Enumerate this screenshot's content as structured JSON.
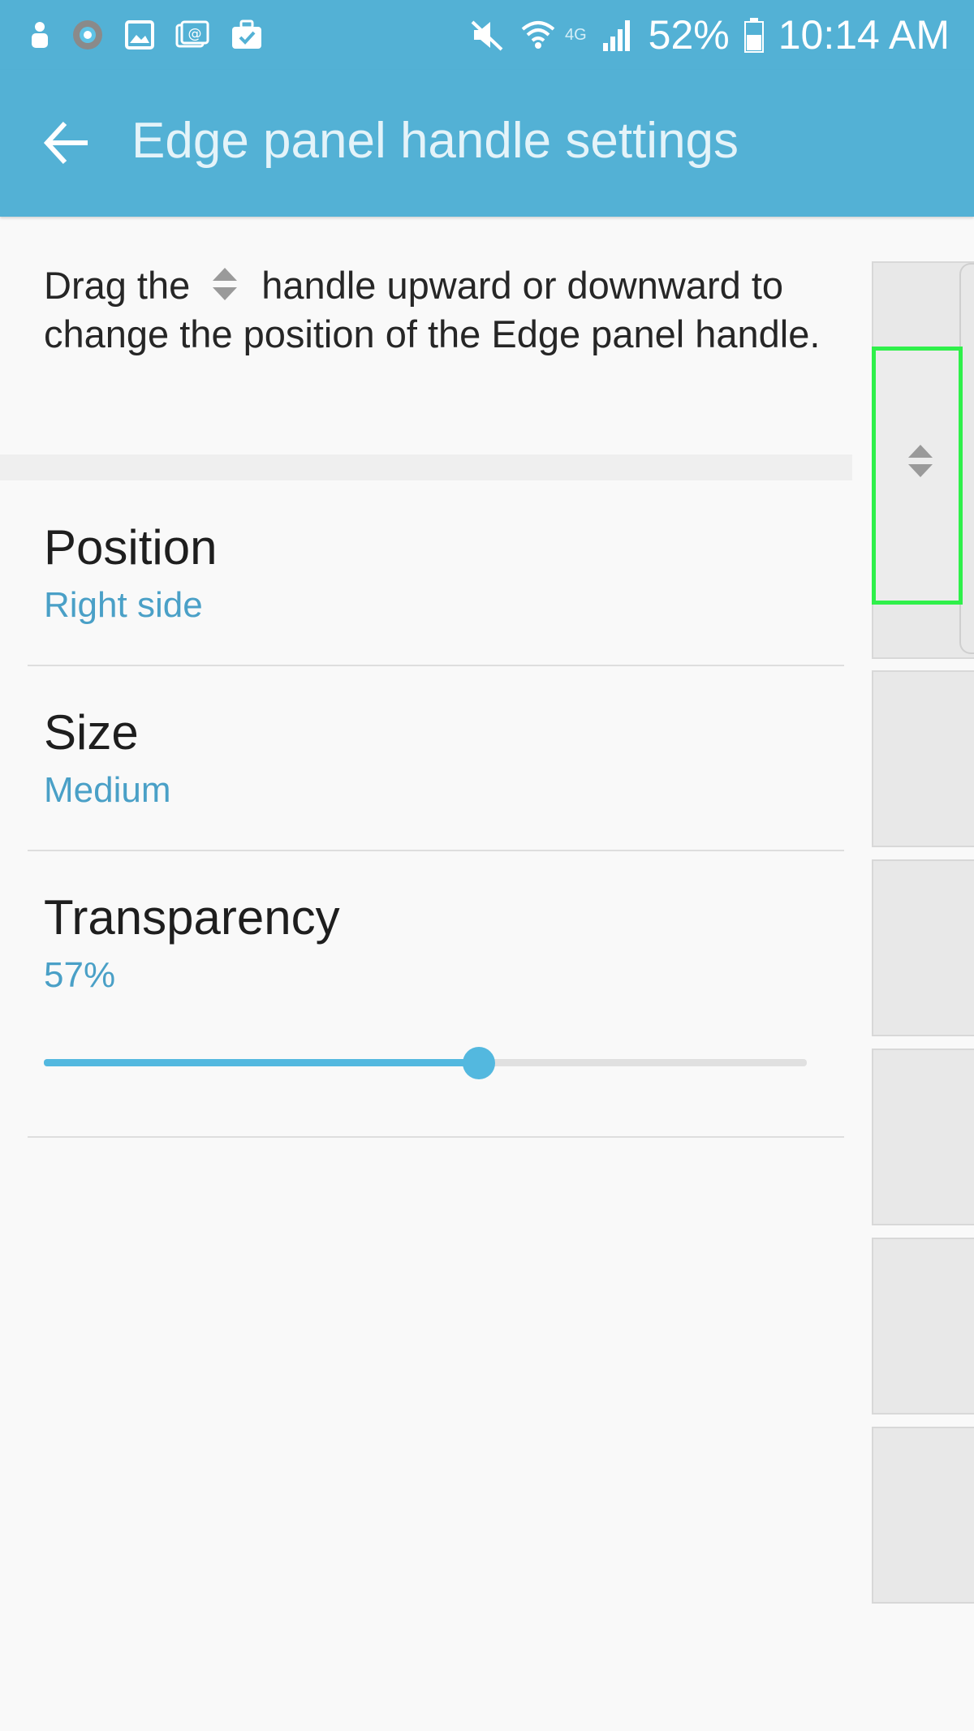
{
  "status_bar": {
    "battery_percent": "52%",
    "time": "10:14 AM",
    "network_label": "4G",
    "icons": [
      "person-icon",
      "gear-notification-icon",
      "image-icon",
      "email-icon",
      "briefcase-check-icon",
      "mute-icon",
      "wifi-icon",
      "signal-icon",
      "battery-icon"
    ]
  },
  "app_bar": {
    "title": "Edge panel handle settings",
    "back_icon": "arrow-left-icon"
  },
  "description": {
    "part1": "Drag the",
    "part2": "handle upward or downward to change the position of the Edge panel handle.",
    "inline_icon": "drag-handle-icon"
  },
  "settings": {
    "position": {
      "title": "Position",
      "value": "Right side"
    },
    "size": {
      "title": "Size",
      "value": "Medium"
    },
    "transparency": {
      "title": "Transparency",
      "value": "57%",
      "slider_fraction": 0.57
    }
  },
  "colors": {
    "bar_background": "#53b1d5",
    "accent": "#4aa0c7",
    "slider": "#53b8df",
    "highlight": "#2ff04a"
  }
}
